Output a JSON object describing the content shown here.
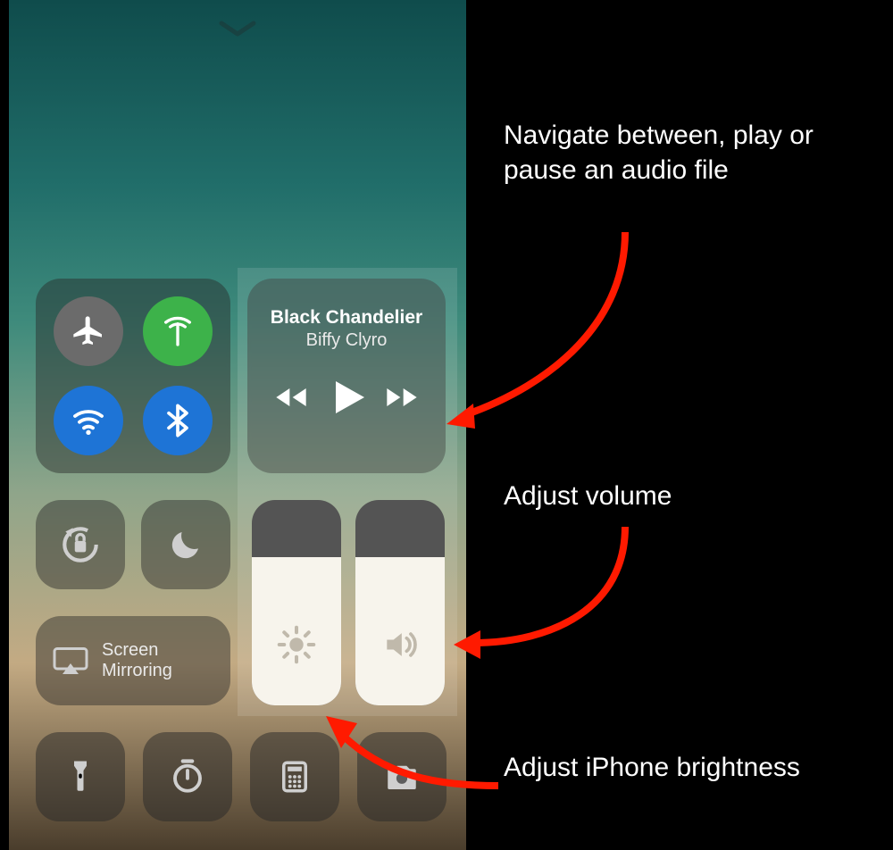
{
  "music": {
    "track_title": "Black Chandelier",
    "artist": "Biffy Clyro"
  },
  "screen_mirroring": {
    "line1": "Screen",
    "line2": "Mirroring"
  },
  "annotations": {
    "a1": "Navigate between, play or pause an audio file",
    "a2": "Adjust volume",
    "a3": "Adjust iPhone brightness"
  },
  "icons": {
    "airplane": "airplane-icon",
    "cellular": "cellular-icon",
    "wifi": "wifi-icon",
    "bluetooth": "bluetooth-icon",
    "rotation_lock": "rotation-lock-icon",
    "dnd": "moon-icon",
    "brightness": "brightness-icon",
    "volume": "volume-icon",
    "airplay": "airplay-icon",
    "flashlight": "flashlight-icon",
    "timer": "timer-icon",
    "calculator": "calculator-icon",
    "camera": "camera-icon"
  },
  "sliders": {
    "brightness_percent": 72,
    "volume_percent": 72
  }
}
